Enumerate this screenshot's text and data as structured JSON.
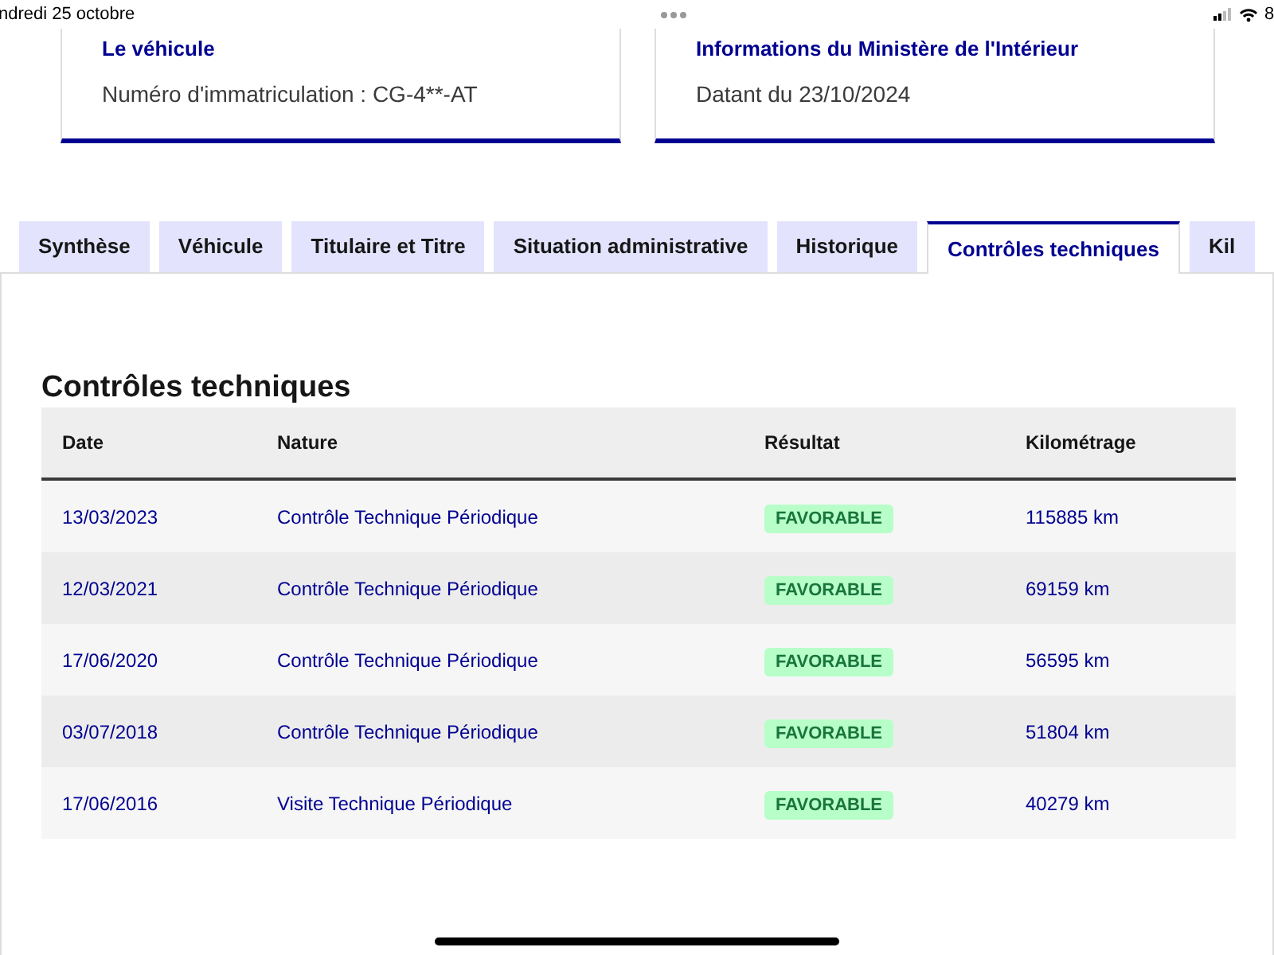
{
  "status_bar": {
    "date": "ndredi 25 octobre",
    "battery": "8"
  },
  "cards": [
    {
      "title": "Le véhicule",
      "text": "Numéro d'immatriculation : CG-4**-AT"
    },
    {
      "title": "Informations du Ministère de l'Intérieur",
      "text": "Datant du 23/10/2024"
    }
  ],
  "tabs": [
    {
      "label": "Synthèse",
      "selected": false
    },
    {
      "label": "Véhicule",
      "selected": false
    },
    {
      "label": "Titulaire et Titre",
      "selected": false
    },
    {
      "label": "Situation administrative",
      "selected": false
    },
    {
      "label": "Historique",
      "selected": false
    },
    {
      "label": "Contrôles techniques",
      "selected": true
    },
    {
      "label": "Kil",
      "selected": false
    }
  ],
  "section_title": "Contrôles techniques",
  "table": {
    "columns": [
      "Date",
      "Nature",
      "Résultat",
      "Kilométrage"
    ],
    "rows": [
      {
        "date": "13/03/2023",
        "nature": "Contrôle Technique Périodique",
        "result": "FAVORABLE",
        "mileage": "115885 km"
      },
      {
        "date": "12/03/2021",
        "nature": "Contrôle Technique Périodique",
        "result": "FAVORABLE",
        "mileage": "69159 km"
      },
      {
        "date": "17/06/2020",
        "nature": "Contrôle Technique Périodique",
        "result": "FAVORABLE",
        "mileage": "56595 km"
      },
      {
        "date": "03/07/2018",
        "nature": "Contrôle Technique Périodique",
        "result": "FAVORABLE",
        "mileage": "51804 km"
      },
      {
        "date": "17/06/2016",
        "nature": "Visite Technique Périodique",
        "result": "FAVORABLE",
        "mileage": "40279 km"
      }
    ]
  }
}
